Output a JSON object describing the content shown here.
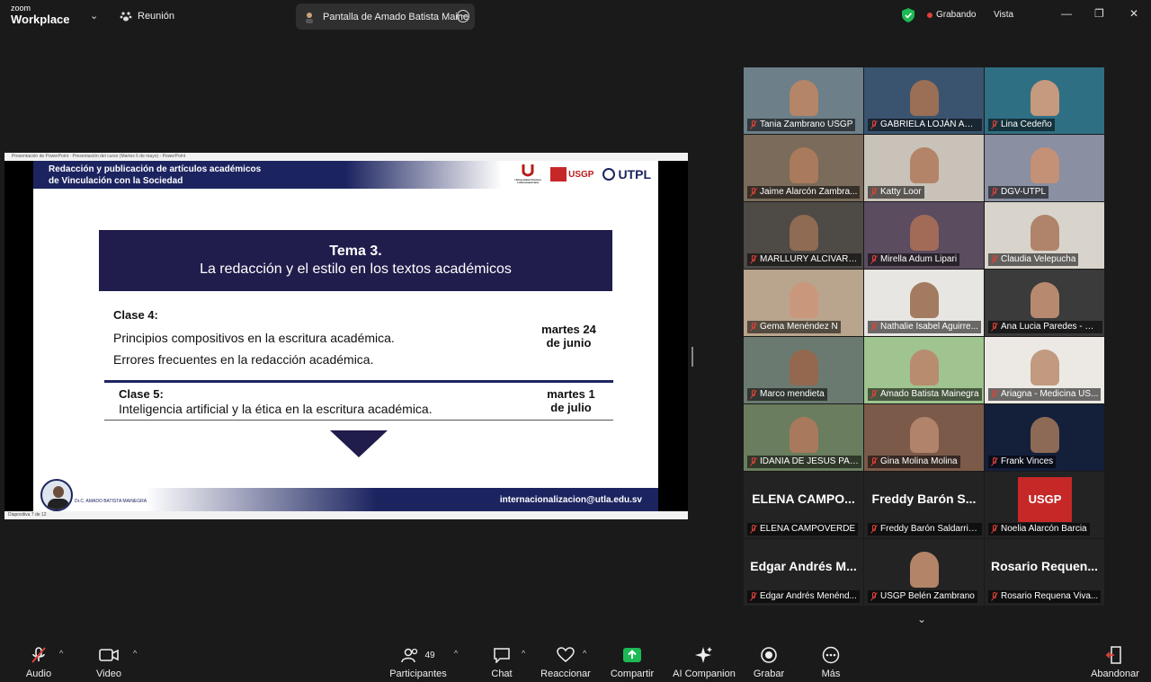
{
  "app": {
    "brand_top": "zoom",
    "brand_bottom": "Workplace",
    "meeting_label": "Reunión"
  },
  "share_pill": {
    "label": "Pantalla de Amado Batista Maine"
  },
  "status": {
    "recording": "Grabando",
    "view": "Vista"
  },
  "window_controls": {
    "minimize": "—",
    "maximize": "❐",
    "close": "✕"
  },
  "ppt": {
    "titlebar": "Presentación de PowerPoint  ·  Presentación del curso (Martes 6 de mayo) - PowerPoint",
    "statusbar": "Diapositiva 7 de 12"
  },
  "slide": {
    "header_line1": "Redacción y publicación de artículos académicos",
    "header_line2": "de Vinculación con la Sociedad",
    "logo1": "Universidad Técnica Latinoamericana",
    "logo2": "USGP",
    "logo3": "UTPL",
    "tema_title": "Tema 3.",
    "tema_subtitle": "La redacción y el estilo en los textos académicos",
    "clase4_title": "Clase 4:",
    "clase4_item1": "Principios compositivos en la escritura académica.",
    "clase4_item2": "Errores frecuentes en la redacción académica.",
    "clase4_date_l1": "martes 24",
    "clase4_date_l2": "de junio",
    "clase5_title": "Clase 5:",
    "clase5_item": "Inteligencia artificial y la ética en la escritura académica.",
    "clase5_date_l1": "martes 1",
    "clase5_date_l2": "de julio",
    "presenter": "Dr.C. AMADO BATISTA MAINEGRA",
    "email": "internacionalizacion@utla.edu.sv"
  },
  "participants": [
    {
      "name": "Tania Zambrano USGP"
    },
    {
      "name": "GABRIELA LOJÁN ABA..."
    },
    {
      "name": "Lina Cedeño"
    },
    {
      "name": "Jaime Alarcón Zambra..."
    },
    {
      "name": "Katty Loor"
    },
    {
      "name": "DGV-UTPL"
    },
    {
      "name": "MARLLURY ALCIVAR U..."
    },
    {
      "name": "Mirella Adum Lipari"
    },
    {
      "name": "Claudia Velepucha"
    },
    {
      "name": "Gema Menéndez N"
    },
    {
      "name": "Nathalie Isabel Aguirre..."
    },
    {
      "name": "Ana Lucia Paredes - US..."
    },
    {
      "name": "Marco mendieta"
    },
    {
      "name": "Amado Batista Mainegra"
    },
    {
      "name": "Ariagna - Medicina US..."
    },
    {
      "name": "IDANIA DE JESUS PAU..."
    },
    {
      "name": "Gina Molina Molina"
    },
    {
      "name": "Frank Vinces"
    },
    {
      "name": "ELENA CAMPOVERDE",
      "big": "ELENA CAMPO..."
    },
    {
      "name": "Freddy Barón Saldarria...",
      "big": "Freddy Barón S..."
    },
    {
      "name": "Noelia Alarcón Barcia",
      "logo": "USGP"
    },
    {
      "name": "Edgar Andrés Menénd...",
      "big": "Edgar Andrés M..."
    },
    {
      "name": "USGP Belén Zambrano"
    },
    {
      "name": "Rosario Requena Viva...",
      "big": "Rosario Requen..."
    }
  ],
  "toolbar": {
    "audio": "Audio",
    "video": "Video",
    "participants": "Participantes",
    "participants_count": "49",
    "chat": "Chat",
    "react": "Reaccionar",
    "share": "Compartir",
    "ai": "AI Companion",
    "record": "Grabar",
    "more": "Más",
    "leave": "Abandonar"
  },
  "colors": {
    "share_green": "#1db954",
    "leave_red": "#e0413a",
    "slide_navy": "#1c2460"
  }
}
